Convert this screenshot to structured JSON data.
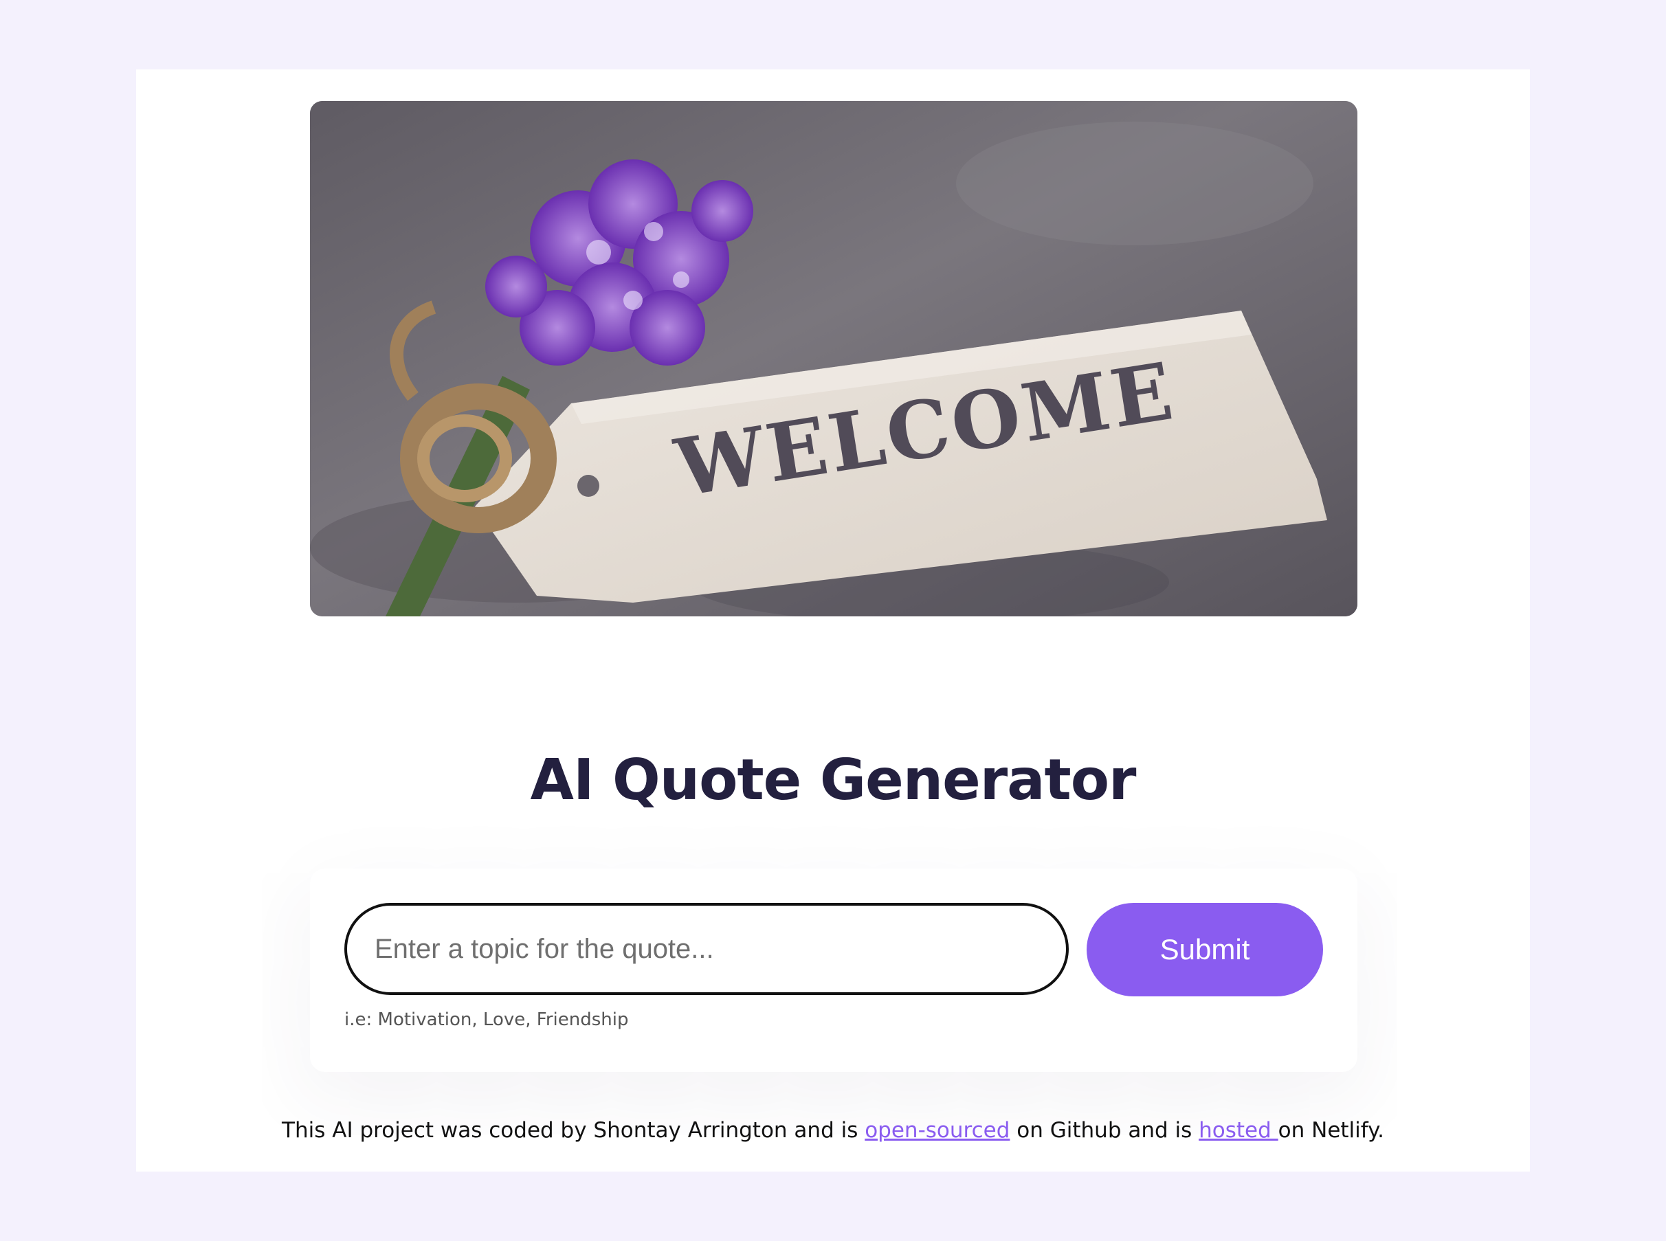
{
  "hero": {
    "image_text": "WELCOME"
  },
  "title": "AI Quote Generator",
  "form": {
    "input_placeholder": "Enter a topic for the quote...",
    "submit_label": "Submit",
    "hint": "i.e: Motivation, Love, Friendship"
  },
  "footer": {
    "text_1": "This AI project was coded by Shontay Arrington and is ",
    "link_1": "open-sourced",
    "text_2": " on Github and is ",
    "link_2": "hosted ",
    "text_3": "on Netlify."
  },
  "colors": {
    "page_background": "#f4f1fd",
    "accent": "#8a5cf0",
    "title": "#23203f"
  }
}
